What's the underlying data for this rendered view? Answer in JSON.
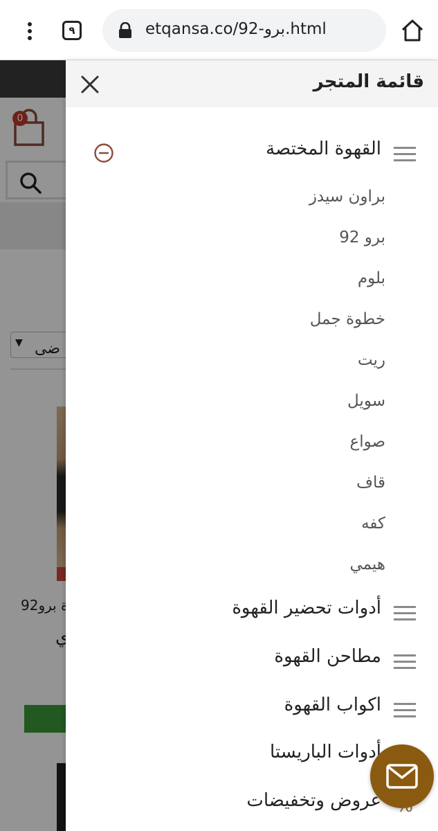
{
  "browser": {
    "tab_count": "٩",
    "url": "etqansa.co/92-برو.html"
  },
  "background_page": {
    "cart_count": "0",
    "sort_select_partial": "ضى",
    "product_name_partial": "ة برو92",
    "product_name_partial_2": "ي"
  },
  "drawer": {
    "title": "قائمة المتجر",
    "categories": [
      {
        "label": "القهوة المختصة",
        "expanded": true,
        "children": [
          "براون سيدز",
          "برو 92",
          "بلوم",
          "خطوة جمل",
          "ريت",
          "سويل",
          "صواع",
          "قاف",
          "كفه",
          "هيمي"
        ]
      },
      {
        "label": "أدوات تحضير القهوة"
      },
      {
        "label": "مطاحن القهوة"
      },
      {
        "label": "اكواب القهوة"
      },
      {
        "label": "أدوات الباريستا"
      },
      {
        "label": "عروض وتخفيضات"
      }
    ]
  },
  "colors": {
    "accent_brown": "#8a5a10",
    "minus_icon": "#8b4a3a",
    "header_bg": "#f4f4f5"
  }
}
